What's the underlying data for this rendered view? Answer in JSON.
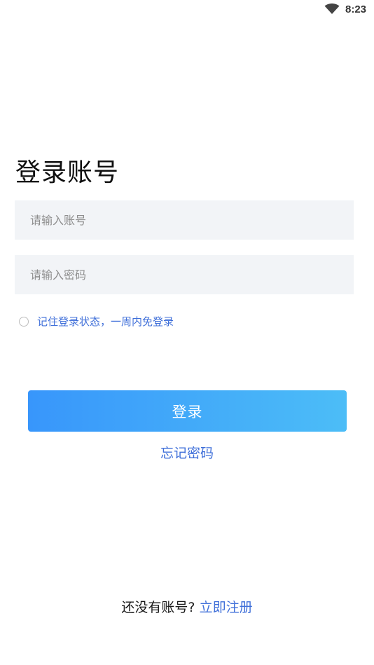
{
  "status_bar": {
    "time": "8:23",
    "wifi_icon": "wifi-icon"
  },
  "login": {
    "title": "登录账号",
    "account_placeholder": "请输入账号",
    "account_value": "",
    "password_placeholder": "请输入密码",
    "password_value": "",
    "remember_label": "记住登录状态，一周内免登录",
    "remember_checked": false,
    "submit_label": "登录",
    "forgot_label": "忘记密码"
  },
  "register": {
    "prompt": "还没有账号?",
    "link_label": "立即注册"
  },
  "colors": {
    "accent": "#3f6fd9",
    "button_gradient_start": "#3896fb",
    "button_gradient_end": "#4cbdf7",
    "input_bg": "#f2f4f7"
  }
}
